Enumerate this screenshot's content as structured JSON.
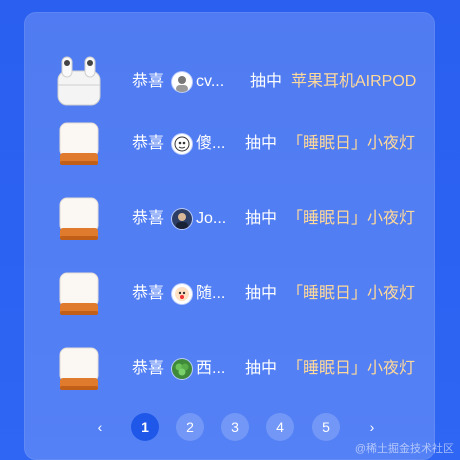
{
  "rows": [
    {
      "congrats": "恭喜",
      "user": "cv...",
      "avatar_icon": "person-avatar",
      "drew": "抽中",
      "prize": "苹果耳机AIRPOD",
      "prize_icon": "airpods-icon"
    },
    {
      "congrats": "恭喜",
      "user": "傻...",
      "avatar_icon": "cartoon-avatar",
      "drew": "抽中",
      "prize": "「睡眠日」小夜灯",
      "prize_icon": "night-lamp-icon"
    },
    {
      "congrats": "恭喜",
      "user": "Jo...",
      "avatar_icon": "person-avatar",
      "drew": "抽中",
      "prize": "「睡眠日」小夜灯",
      "prize_icon": "night-lamp-icon"
    },
    {
      "congrats": "恭喜",
      "user": "随...",
      "avatar_icon": "cartoon-avatar",
      "drew": "抽中",
      "prize": "「睡眠日」小夜灯",
      "prize_icon": "night-lamp-icon"
    },
    {
      "congrats": "恭喜",
      "user": "西...",
      "avatar_icon": "plant-avatar",
      "drew": "抽中",
      "prize": "「睡眠日」小夜灯",
      "prize_icon": "night-lamp-icon"
    }
  ],
  "pagination": {
    "prev": "‹",
    "pages": [
      "1",
      "2",
      "3",
      "4",
      "5"
    ],
    "active_page": "1",
    "next": "›"
  },
  "watermark": "@稀土掘金技术社区",
  "colors": {
    "background": "#2c62f1",
    "prize_text": "#ffd99a",
    "active_page": "#1f57e8"
  }
}
